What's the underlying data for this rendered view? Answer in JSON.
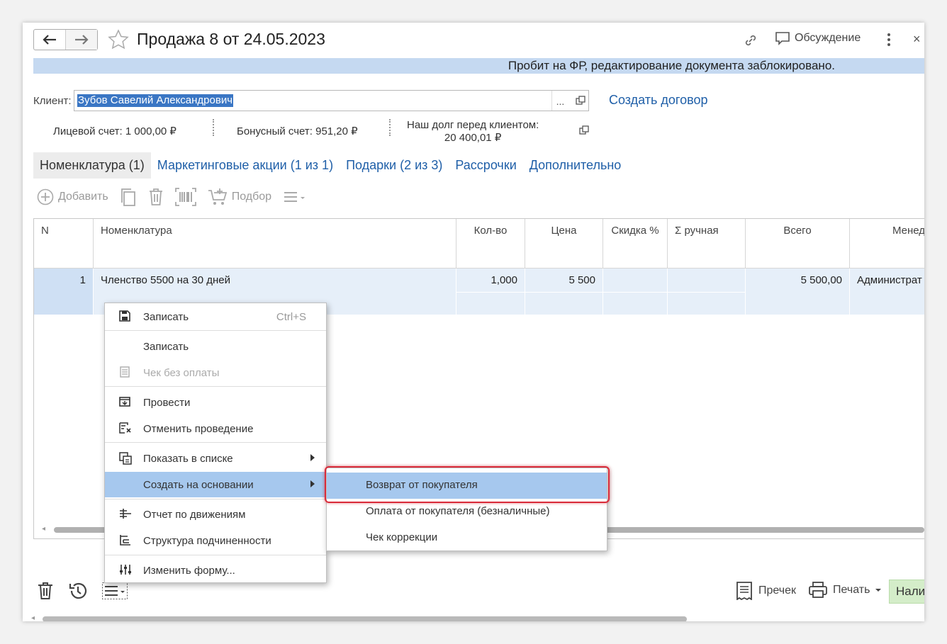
{
  "window": {
    "title": "Продажа 8 от 24.05.2023",
    "discussion_label": "Обсуждение",
    "close_label": "×"
  },
  "info_bar": {
    "text": "Пробит на ФР, редактирование документа заблокировано."
  },
  "client": {
    "label": "Клиент:",
    "value": "Зубов Савелий Александрович",
    "select_button": "...",
    "create_contract": "Создать договор"
  },
  "summaries": {
    "account": "Лицевой счет: 1 000,00 ₽",
    "bonus": "Бонусный счет: 951,20 ₽",
    "debt_label": "Наш долг перед клиентом:",
    "debt_value": "20 400,01 ₽"
  },
  "tabs": [
    {
      "label": "Номенклатура (1)",
      "active": true
    },
    {
      "label": "Маркетинговые акции (1 из 1)",
      "active": false
    },
    {
      "label": "Подарки (2 из 3)",
      "active": false
    },
    {
      "label": "Рассрочки",
      "active": false
    },
    {
      "label": "Дополнительно",
      "active": false
    }
  ],
  "toolbar": {
    "add_label": "Добавить",
    "pick_label": "Подбор"
  },
  "table": {
    "headers": {
      "n": "N",
      "item": "Номенклатура",
      "qty": "Кол-во",
      "price": "Цена",
      "discount": "Скидка %",
      "manual": "Σ ручная",
      "total": "Всего",
      "manager": "Менед"
    },
    "rows": [
      {
        "n": "1",
        "item": "Членство 5500 на 30 дней",
        "qty": "1,000",
        "price": "5 500",
        "discount": "",
        "manual": "",
        "total": "5 500,00",
        "manager": "Администрат"
      }
    ]
  },
  "context_menu": {
    "items": [
      {
        "label": "Записать",
        "shortcut": "Ctrl+S",
        "icon": "save-icon"
      },
      {
        "label": "Записать"
      },
      {
        "label": "Чек без оплаты",
        "disabled": true,
        "icon": "receipt-icon"
      },
      {
        "label": "Провести",
        "icon": "post-icon"
      },
      {
        "label": "Отменить проведение",
        "icon": "unpost-icon"
      },
      {
        "label": "Показать в списке",
        "submenu": true,
        "icon": "show-in-list-icon"
      },
      {
        "label": "Создать на основании",
        "submenu": true,
        "highlighted": true
      },
      {
        "label": "Отчет по движениям",
        "icon": "movements-report-icon"
      },
      {
        "label": "Структура подчиненности",
        "icon": "hierarchy-icon"
      },
      {
        "label": "Изменить форму...",
        "icon": "customize-form-icon"
      }
    ]
  },
  "submenu": {
    "items": [
      {
        "label": "Возврат от покупателя",
        "highlighted": true
      },
      {
        "label": "Оплата от покупателя (безналичные)"
      },
      {
        "label": "Чек коррекции"
      }
    ]
  },
  "footer": {
    "precheck_label": "Пречек",
    "print_label": "Печать",
    "primary_label": "Нали"
  },
  "colors": {
    "accent_link": "#1f5fa8",
    "info_bar": "#c5d9f1",
    "menu_highlight": "#a6c8ee",
    "selected_row": "#e6eff9",
    "outline_red": "#d92b3a",
    "primary_button": "#d4edc9"
  }
}
